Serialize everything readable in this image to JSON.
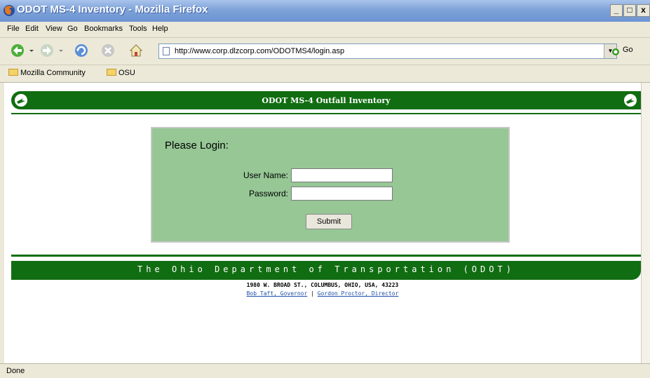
{
  "window": {
    "title": "ODOT MS-4 Inventory - Mozilla Firefox",
    "minimize": "_",
    "maximize": "□",
    "close": "x"
  },
  "menu": [
    "File",
    "Edit",
    "View",
    "Go",
    "Bookmarks",
    "Tools",
    "Help"
  ],
  "nav": {
    "url": "http://www.corp.dlzcorp.com/ODOTMS4/login.asp",
    "go_label": "Go"
  },
  "bookmarks": [
    "Mozilla Community",
    "OSU"
  ],
  "page": {
    "header_title": "ODOT MS-4 Outfall Inventory",
    "login": {
      "title": "Please Login:",
      "username_label": "User Name:",
      "password_label": "Password:",
      "username_value": "",
      "password_value": "",
      "submit_label": "Submit"
    },
    "footer_title": "The Ohio Department of Transportation (ODOT)",
    "address": "1980 W. BROAD ST., COLUMBUS, OHIO, USA, 43223",
    "links": {
      "governor": "Bob Taft, Governor",
      "separator": "|",
      "director": "Gordon Proctor, Director"
    }
  },
  "status": "Done",
  "colors": {
    "odot_green": "#116d11",
    "login_bg": "#96c795",
    "link": "#1c4fa7"
  }
}
